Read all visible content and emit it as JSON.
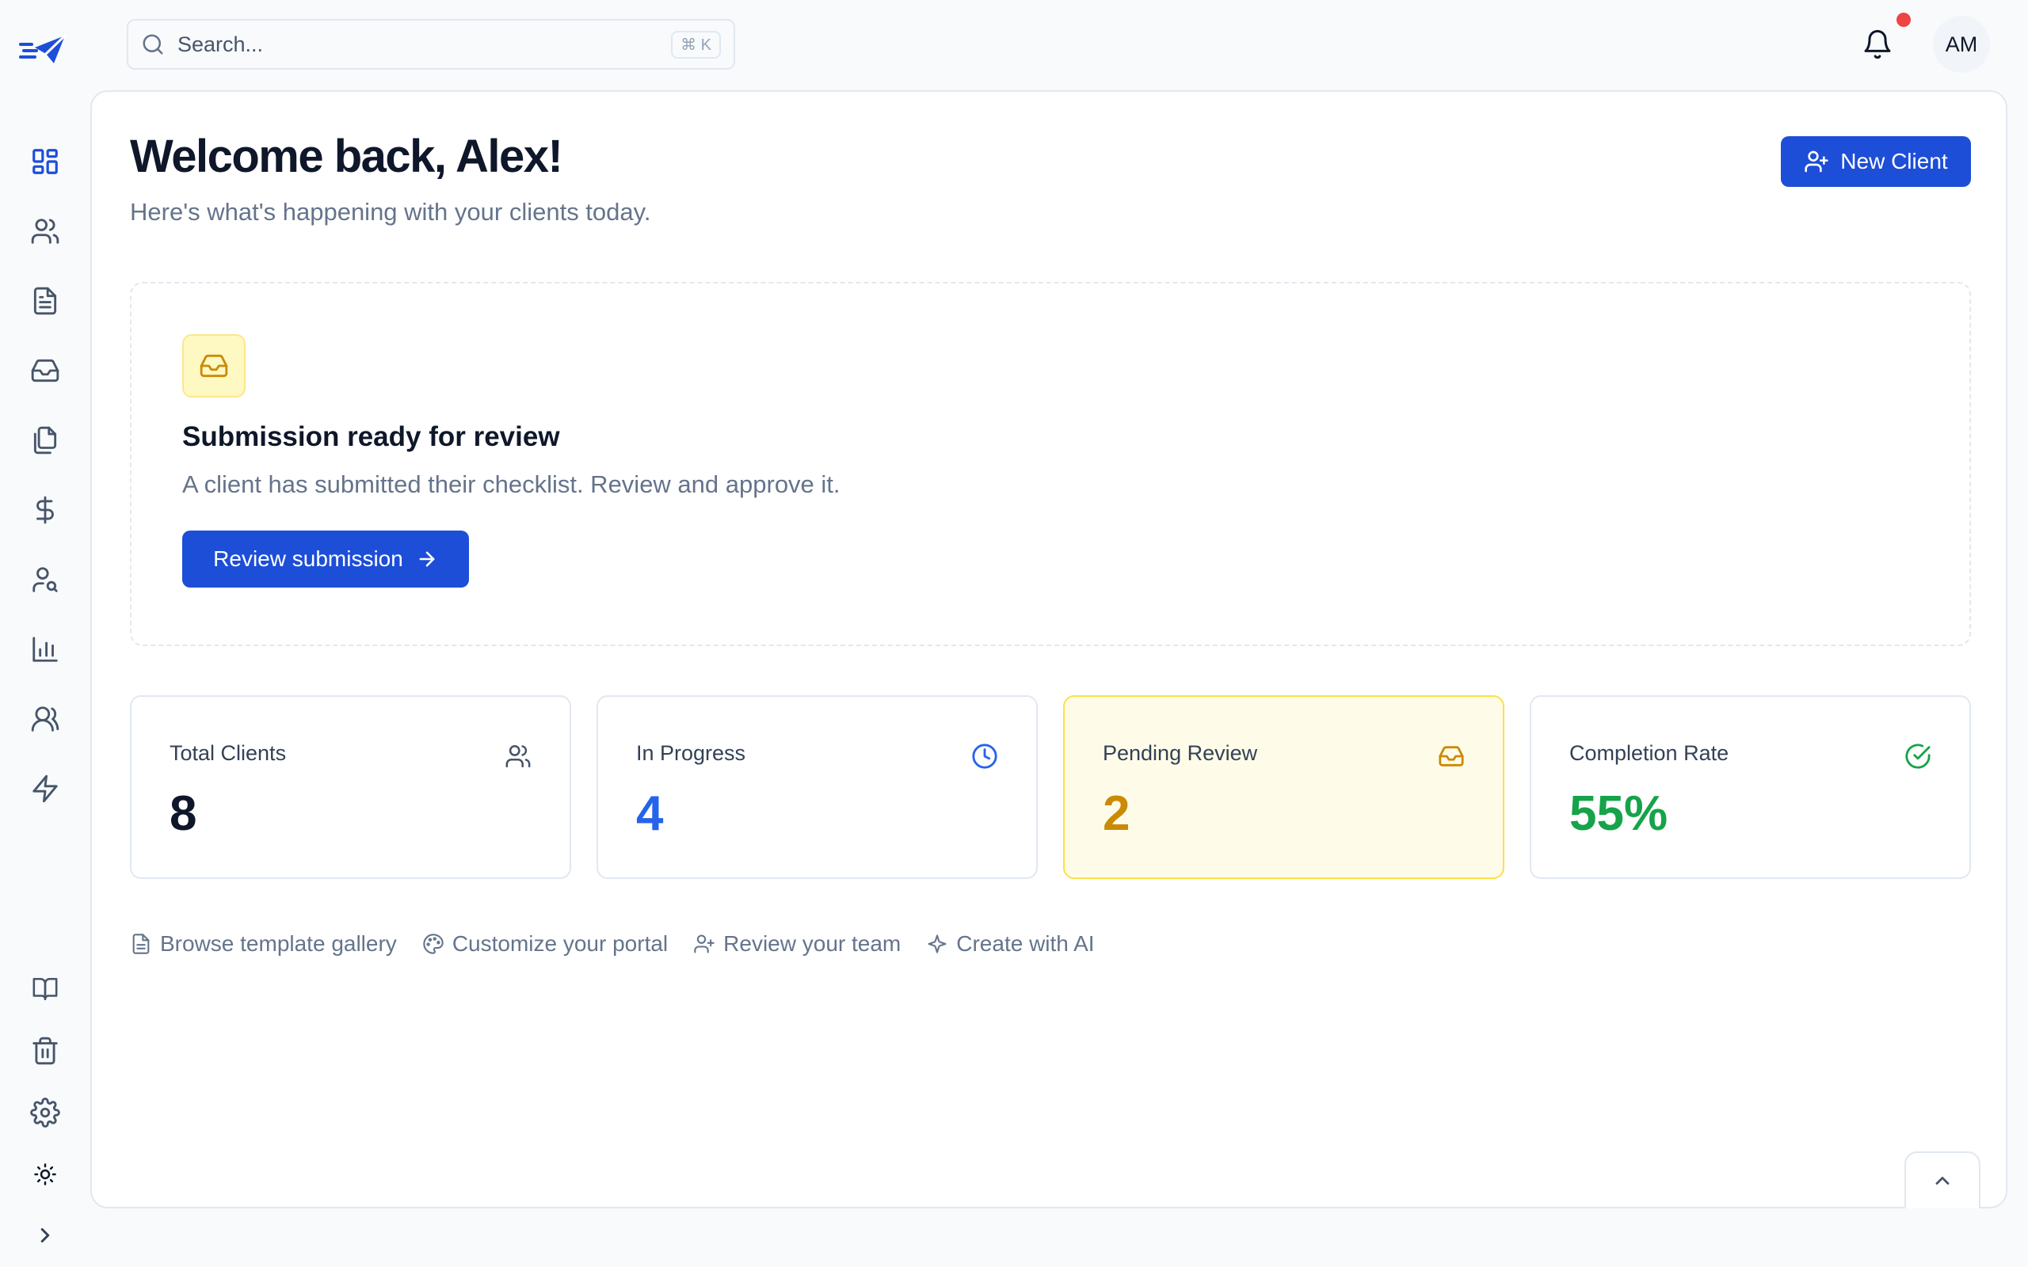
{
  "app": {
    "logo_icon": "paper-plane-fast-icon",
    "brand_color": "#1d4ed8"
  },
  "sidebar": {
    "top_items": [
      {
        "icon": "dashboard-icon",
        "active": true
      },
      {
        "icon": "users-icon"
      },
      {
        "icon": "document-icon"
      },
      {
        "icon": "inbox-icon"
      },
      {
        "icon": "copy-files-icon"
      },
      {
        "icon": "dollar-icon"
      },
      {
        "icon": "user-search-icon"
      },
      {
        "icon": "bar-chart-icon"
      },
      {
        "icon": "team-icon"
      },
      {
        "icon": "lightning-icon"
      }
    ],
    "bottom_items": [
      {
        "icon": "book-icon"
      },
      {
        "icon": "trash-icon"
      },
      {
        "icon": "settings-gear-icon"
      },
      {
        "icon": "sun-theme-icon"
      }
    ],
    "expand_icon": "chevron-right-icon"
  },
  "topbar": {
    "search_placeholder": "Search...",
    "search_shortcut": "⌘ K",
    "has_notification": true,
    "avatar_initials": "AM"
  },
  "header": {
    "title": "Welcome back, Alex!",
    "subtitle": "Here's what's happening with your clients today.",
    "new_client_label": "New Client"
  },
  "review_card": {
    "title": "Submission ready for review",
    "description": "A client has submitted their checklist. Review and approve it.",
    "button_label": "Review submission"
  },
  "stats": [
    {
      "label": "Total Clients",
      "value": "8",
      "icon": "users-icon",
      "color": "#0f172a"
    },
    {
      "label": "In Progress",
      "value": "4",
      "icon": "clock-icon",
      "color": "#2563eb"
    },
    {
      "label": "Pending Review",
      "value": "2",
      "icon": "inbox-icon",
      "color": "#ca8a04"
    },
    {
      "label": "Completion Rate",
      "value": "55%",
      "icon": "check-circle-icon",
      "color": "#16a34a"
    }
  ],
  "quick_links": [
    {
      "label": "Browse template gallery",
      "icon": "document-icon"
    },
    {
      "label": "Customize your portal",
      "icon": "palette-icon"
    },
    {
      "label": "Review your team",
      "icon": "user-plus-icon"
    },
    {
      "label": "Create with AI",
      "icon": "sparkles-icon"
    }
  ]
}
